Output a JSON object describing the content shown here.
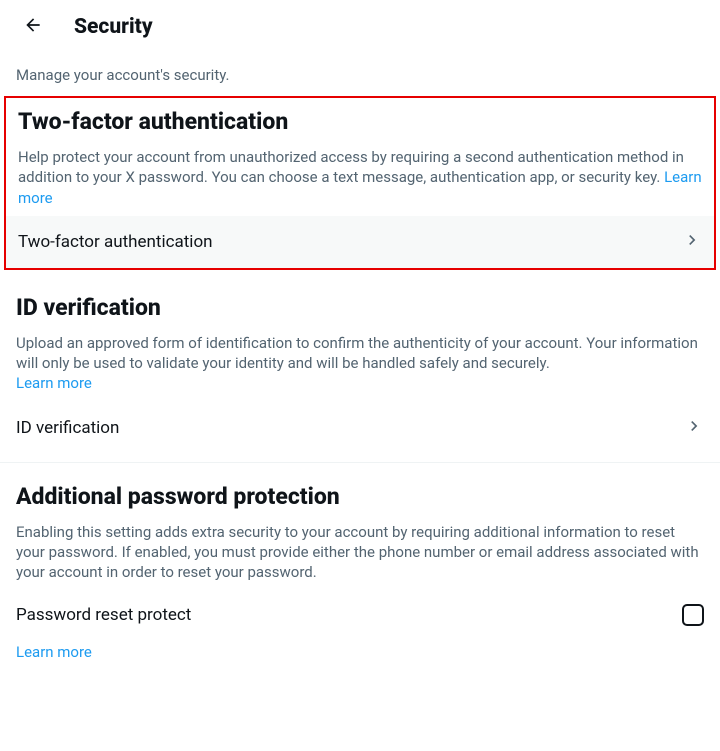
{
  "header": {
    "title": "Security",
    "subtitle": "Manage your account's security."
  },
  "tfa": {
    "heading": "Two-factor authentication",
    "desc": "Help protect your account from unauthorized access by requiring a second authentication method in addition to your X password. You can choose a text message, authentication app, or security key. ",
    "learn": "Learn more",
    "row_label": "Two-factor authentication"
  },
  "idv": {
    "heading": "ID verification",
    "desc": "Upload an approved form of identification to confirm the authenticity of your account. Your information will only be used to validate your identity and will be handled safely and securely. ",
    "learn": "Learn more",
    "row_label": "ID verification"
  },
  "app": {
    "heading": "Additional password protection",
    "desc": "Enabling this setting adds extra security to your account by requiring additional information to reset your password. If enabled, you must provide either the phone number or email address associated with your account in order to reset your password.",
    "row_label": "Password reset protect",
    "learn": "Learn more"
  }
}
